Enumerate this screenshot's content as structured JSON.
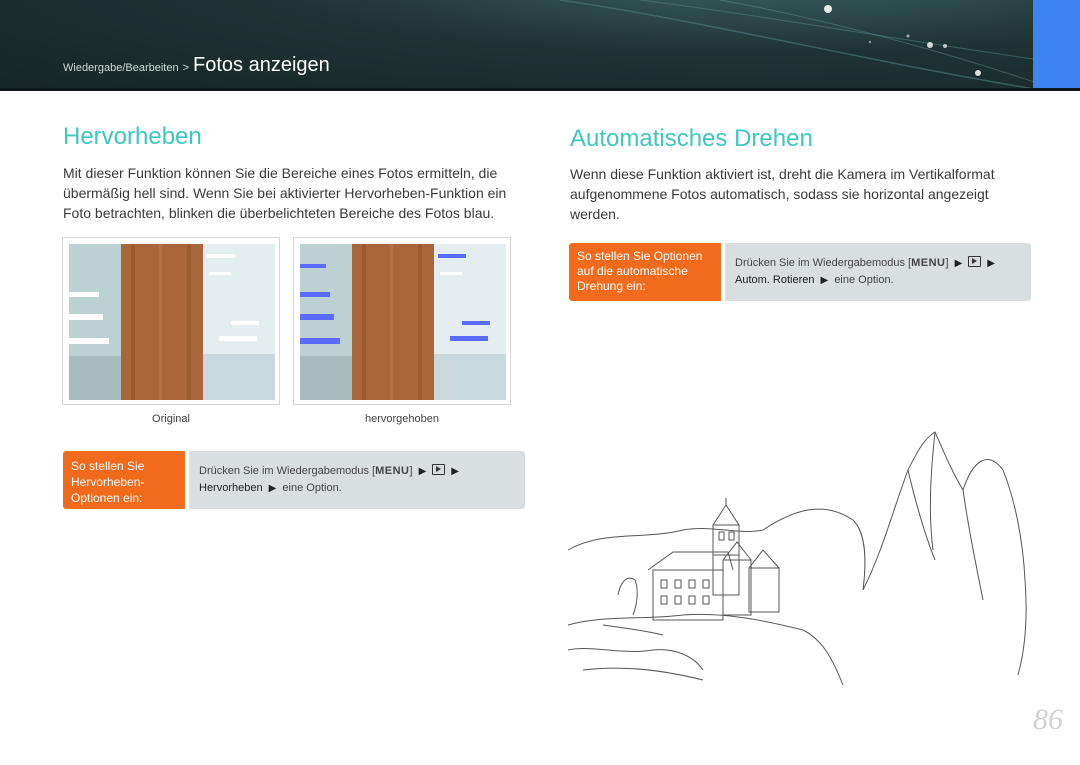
{
  "header": {
    "breadcrumb_parent": "Wiedergabe/Bearbeiten",
    "breadcrumb_sep": ">",
    "breadcrumb_current": "Fotos anzeigen"
  },
  "left": {
    "title": "Hervorheben",
    "body": "Mit dieser Funktion können Sie die Bereiche eines Fotos ermitteln, die übermäßig hell sind. Wenn Sie bei aktivierter Hervorheben-Funktion ein Foto betrachten, blinken die überbelichteten Bereiche des Fotos blau.",
    "photo_captions": [
      "Original",
      "hervorgehoben"
    ],
    "howto": {
      "label": "So stellen Sie Hervorheben-Optionen ein:",
      "line1_prefix": "Drücken Sie im Wiedergabemodus [",
      "menu_key": "MENU",
      "line1_suffix": "]",
      "line2_item": "Hervorheben",
      "line2_suffix": "eine Option."
    }
  },
  "right": {
    "title": "Automatisches Drehen",
    "body": "Wenn diese Funktion aktiviert ist, dreht die Kamera im Vertikalformat aufgenommene Fotos automatisch, sodass sie horizontal angezeigt werden.",
    "howto": {
      "label": "So stellen Sie Optionen auf die automatische Drehung ein:",
      "line1_prefix": "Drücken Sie im Wiedergabemodus [",
      "menu_key": "MENU",
      "line1_suffix": "]",
      "line2_item": "Autom. Rotieren",
      "line2_suffix": "eine Option."
    }
  },
  "page_number": "86",
  "icons": [
    "arrow-right-icon",
    "playback-icon"
  ],
  "colors": {
    "title": "#3ec7c0",
    "howto_label": "#f26b1d",
    "howto_bg": "#d9dfe0",
    "header_accent": "#3d84f0",
    "highlight_blue": "#5a6cff"
  }
}
